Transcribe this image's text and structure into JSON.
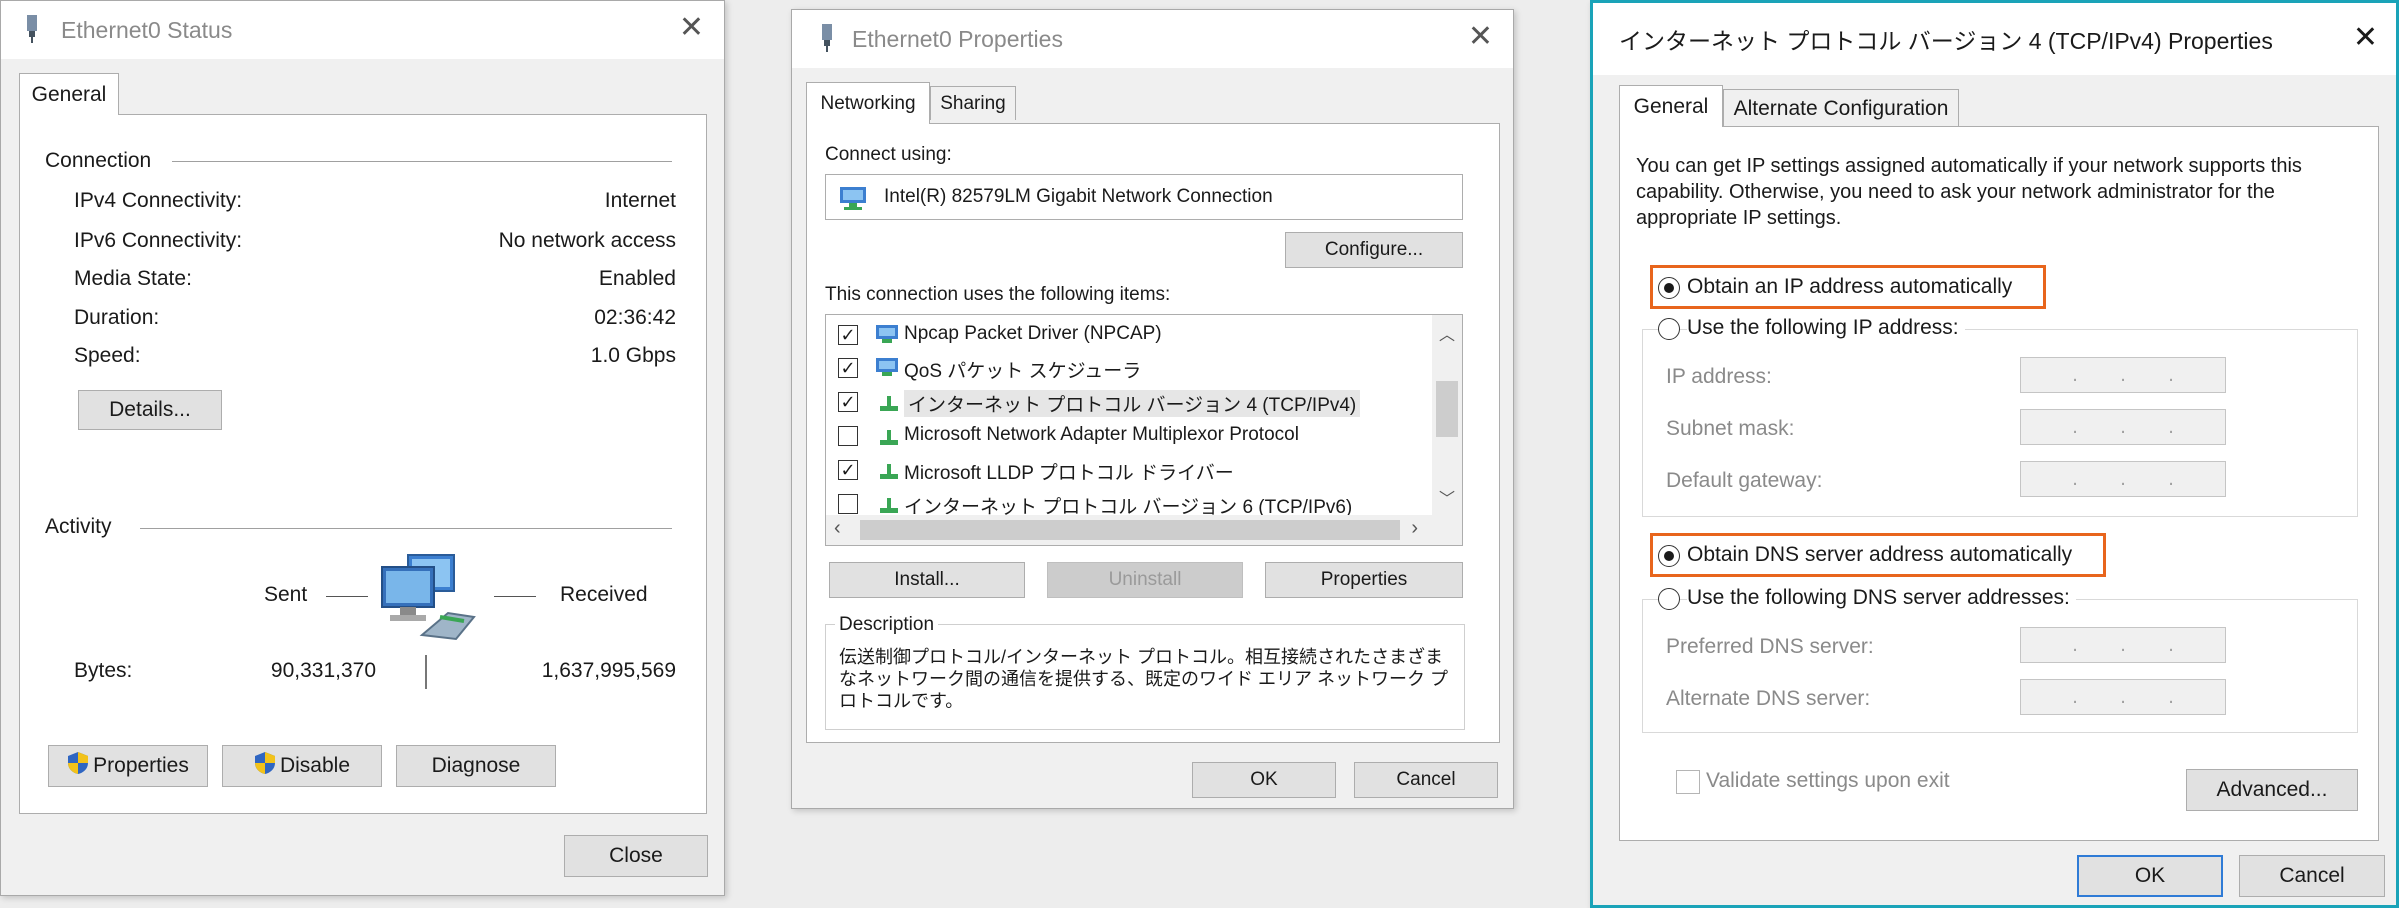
{
  "status_dialog": {
    "title": "Ethernet0 Status",
    "tab_general": "General",
    "connection_header": "Connection",
    "rows": [
      {
        "label": "IPv4 Connectivity:",
        "value": "Internet"
      },
      {
        "label": "IPv6 Connectivity:",
        "value": "No network access"
      },
      {
        "label": "Media State:",
        "value": "Enabled"
      },
      {
        "label": "Duration:",
        "value": "02:36:42"
      },
      {
        "label": "Speed:",
        "value": "1.0 Gbps"
      }
    ],
    "details_button": "Details...",
    "activity_header": "Activity",
    "sent_label": "Sent",
    "received_label": "Received",
    "bytes_label": "Bytes:",
    "bytes_sent": "90,331,370",
    "bytes_received": "1,637,995,569",
    "properties_button": "Properties",
    "disable_button": "Disable",
    "diagnose_button": "Diagnose",
    "close_button": "Close"
  },
  "properties_dialog": {
    "title": "Ethernet0 Properties",
    "tab_networking": "Networking",
    "tab_sharing": "Sharing",
    "connect_using_label": "Connect using:",
    "adapter_name": "Intel(R) 82579LM Gigabit Network Connection",
    "configure_button": "Configure...",
    "items_label": "This connection uses the following items:",
    "items": [
      {
        "label": "Npcap Packet Driver (NPCAP)",
        "checked": true
      },
      {
        "label": "QoS パケット スケジューラ",
        "checked": true
      },
      {
        "label": "インターネット プロトコル バージョン 4 (TCP/IPv4)",
        "checked": true
      },
      {
        "label": "Microsoft Network Adapter Multiplexor Protocol",
        "checked": false
      },
      {
        "label": "Microsoft LLDP プロトコル ドライバー",
        "checked": true
      },
      {
        "label": "インターネット プロトコル バージョン 6 (TCP/IPv6)",
        "checked": false
      }
    ],
    "install_button": "Install...",
    "uninstall_button": "Uninstall",
    "properties_button": "Properties",
    "description_label": "Description",
    "description_text": "伝送制御プロトコル/インターネット プロトコル。相互接続されたさまざまなネットワーク間の通信を提供する、既定のワイド エリア ネットワーク プロトコルです。",
    "ok_button": "OK",
    "cancel_button": "Cancel"
  },
  "ipv4_dialog": {
    "title": "インターネット プロトコル バージョン 4 (TCP/IPv4) Properties",
    "tab_general": "General",
    "tab_alternate": "Alternate Configuration",
    "intro_text": "You can get IP settings assigned automatically if your network supports this capability. Otherwise, you need to ask your network administrator for the appropriate IP settings.",
    "obtain_ip_auto": "Obtain an IP address automatically",
    "use_following_ip": "Use the following IP address:",
    "ip_address_label": "IP address:",
    "subnet_mask_label": "Subnet mask:",
    "default_gateway_label": "Default gateway:",
    "obtain_dns_auto": "Obtain DNS server address automatically",
    "use_following_dns": "Use the following DNS server addresses:",
    "preferred_dns_label": "Preferred DNS server:",
    "alternate_dns_label": "Alternate DNS server:",
    "validate_label": "Validate settings upon exit",
    "advanced_button": "Advanced...",
    "ok_button": "OK",
    "cancel_button": "Cancel",
    "ip_dots": ". . .",
    "highlight_color": "#e8651c",
    "accent_color": "#2f7bd6"
  },
  "icons": {
    "title_icon": "network-adapter-icon",
    "shield": "uac-shield-icon",
    "computers": "network-computers-icon"
  }
}
